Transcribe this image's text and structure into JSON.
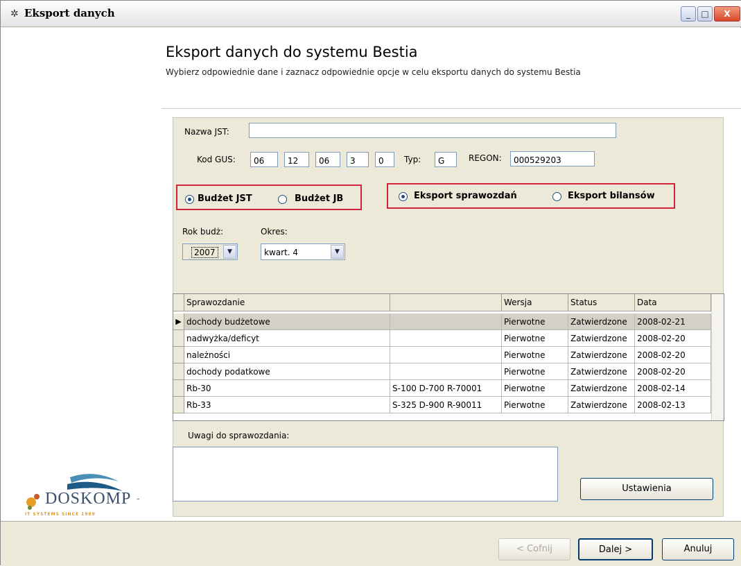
{
  "window": {
    "title": "Eksport danych",
    "minimize_glyph": "_",
    "maximize_glyph": "□",
    "close_glyph": "X"
  },
  "header": {
    "title": "Eksport danych do systemu Bestia",
    "subtitle": "Wybierz odpowiednie dane i zaznacz odpowiednie opcje w celu eksportu danych do systemu Bestia"
  },
  "form": {
    "nazwa_label": "Nazwa JST:",
    "nazwa_value": "",
    "kodgus_label": "Kod GUS:",
    "kodgus_values": [
      "06",
      "12",
      "06",
      "3",
      "0"
    ],
    "typ_label": "Typ:",
    "typ_value": "G",
    "regon_label": "REGON:",
    "regon_value": "000529203",
    "budget_options": [
      {
        "label": "Budżet JST",
        "selected": true
      },
      {
        "label": "Budżet JB",
        "selected": false
      }
    ],
    "export_options": [
      {
        "label": "Eksport sprawozdań",
        "selected": true
      },
      {
        "label": "Eksport bilansów",
        "selected": false
      }
    ],
    "rok_label": "Rok budż:",
    "rok_value": "2007",
    "okres_label": "Okres:",
    "okres_value": "kwart. 4"
  },
  "table": {
    "columns": [
      "Sprawozdanie",
      "",
      "Wersja",
      "Status",
      "Data"
    ],
    "rows": [
      {
        "name": "dochody budżetowe",
        "code": "",
        "version": "Pierwotne",
        "status": "Zatwierdzone",
        "date": "2008-02-21",
        "selected": true
      },
      {
        "name": "nadwyżka/deficyt",
        "code": "",
        "version": "Pierwotne",
        "status": "Zatwierdzone",
        "date": "2008-02-20",
        "selected": false
      },
      {
        "name": "należności",
        "code": "",
        "version": "Pierwotne",
        "status": "Zatwierdzone",
        "date": "2008-02-20",
        "selected": false
      },
      {
        "name": "dochody podatkowe",
        "code": "",
        "version": "Pierwotne",
        "status": "Zatwierdzone",
        "date": "2008-02-20",
        "selected": false
      },
      {
        "name": "Rb-30",
        "code": "S-100 D-700 R-70001",
        "version": "Pierwotne",
        "status": "Zatwierdzone",
        "date": "2008-02-14",
        "selected": false
      },
      {
        "name": "Rb-33",
        "code": "S-325 D-900 R-90011",
        "version": "Pierwotne",
        "status": "Zatwierdzone",
        "date": "2008-02-13",
        "selected": false
      }
    ],
    "selected_marker": "▶"
  },
  "notes": {
    "label": "Uwagi do sprawozdania:",
    "value": ""
  },
  "buttons": {
    "settings": "Ustawienia",
    "back": "< Cofnij",
    "next": "Dalej >",
    "cancel": "Anuluj"
  },
  "logo": {
    "name": "DOSKOMP",
    "tagline": "IT SYSTEMS SINCE 1989"
  },
  "colors": {
    "highlight_border": "#d3233b",
    "panel_bg": "#ece9d8"
  }
}
